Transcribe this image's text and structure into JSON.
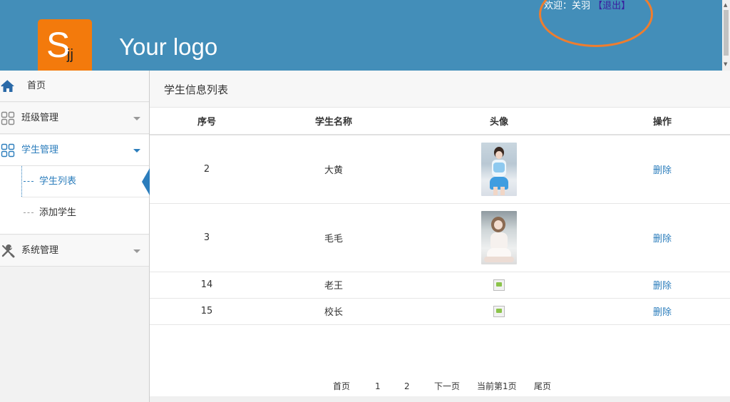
{
  "header": {
    "logo_letter": "S",
    "logo_sub": "jj",
    "logo_text": "Your logo",
    "welcome_prefix": "欢迎：关羽",
    "logout_label": "【退出】"
  },
  "sidebar": {
    "items": [
      {
        "label": "首页",
        "icon": "home-icon"
      },
      {
        "label": "班级管理",
        "icon": "grid-icon"
      },
      {
        "label": "学生管理",
        "icon": "grid-icon",
        "active": true
      },
      {
        "label": "系统管理",
        "icon": "tools-icon"
      }
    ],
    "submenu": [
      {
        "label": "学生列表",
        "active": true
      },
      {
        "label": "添加学生"
      }
    ]
  },
  "main": {
    "title": "学生信息列表",
    "columns": [
      "序号",
      "学生名称",
      "头像",
      "操作"
    ],
    "rows": [
      {
        "id": "2",
        "name": "大黄",
        "avatar": "photo",
        "action": "删除"
      },
      {
        "id": "3",
        "name": "毛毛",
        "avatar": "photo",
        "action": "删除"
      },
      {
        "id": "14",
        "name": "老王",
        "avatar": "broken",
        "action": "删除"
      },
      {
        "id": "15",
        "name": "校长",
        "avatar": "broken",
        "action": "删除"
      }
    ],
    "pagination": {
      "first": "首页",
      "page1": "1",
      "page2": "2",
      "next": "下一页",
      "current": "当前第1页",
      "last": "尾页"
    }
  },
  "colors": {
    "header_bg": "#438eb9",
    "logo_bg": "#f37a0c",
    "accent": "#2b7dbc",
    "annotation_circle": "#ef7d2e"
  }
}
